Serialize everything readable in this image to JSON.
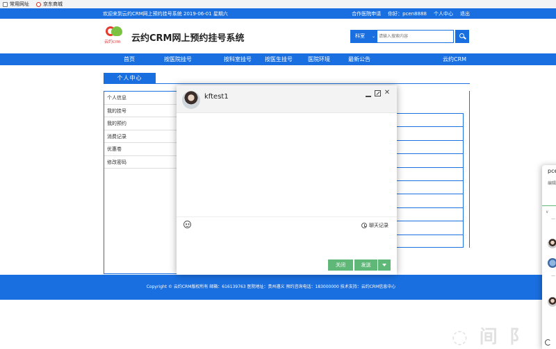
{
  "bookmarks": [
    {
      "label": "常用网址",
      "icon": "document-icon"
    },
    {
      "label": "京东商城",
      "icon": "jd-icon"
    }
  ],
  "topbar": {
    "welcome": "欢迎来到云约CRM网上预约挂号系统 2019-06-01 星期六",
    "cooperation": "合作医院申请",
    "greeting": "你好：pcen8888",
    "personal_center": "个人中心",
    "logout": "退出"
  },
  "header": {
    "logo_text": "云约crm",
    "site_title": "云约CRM网上预约挂号系统",
    "search_scope": "科室",
    "search_placeholder": "请输入搜索内容"
  },
  "nav": {
    "items": [
      "首页",
      "按医院挂号",
      "按科室挂号",
      "按医生挂号",
      "医院环境",
      "最新公告",
      "云约CRM"
    ]
  },
  "section": {
    "tab_label": "个人中心",
    "menu": [
      "个人信息",
      "我的挂号",
      "我的预约",
      "消费记录",
      "优惠卷",
      "修改密码"
    ]
  },
  "footer": {
    "text": "Copyright © 云约CRM版权所有  邮箱：616139763  医院地址：贵州遵义  预约咨询电话：183000000  技术支持：云约CRM信息中心"
  },
  "chat": {
    "contact_name": "kftest1",
    "history_label": "聊天记录",
    "close_label": "关闭",
    "send_label": "发送",
    "minimize_icon": "minimize-icon",
    "maximize_icon": "maximize-icon",
    "close_icon": "close-icon"
  },
  "right_panel": {
    "name": "pce",
    "sub": "编辑",
    "dash1": "一",
    "dash2": "一"
  },
  "colors": {
    "brand_blue": "#1a6fe0",
    "button_green": "#5fb878"
  }
}
